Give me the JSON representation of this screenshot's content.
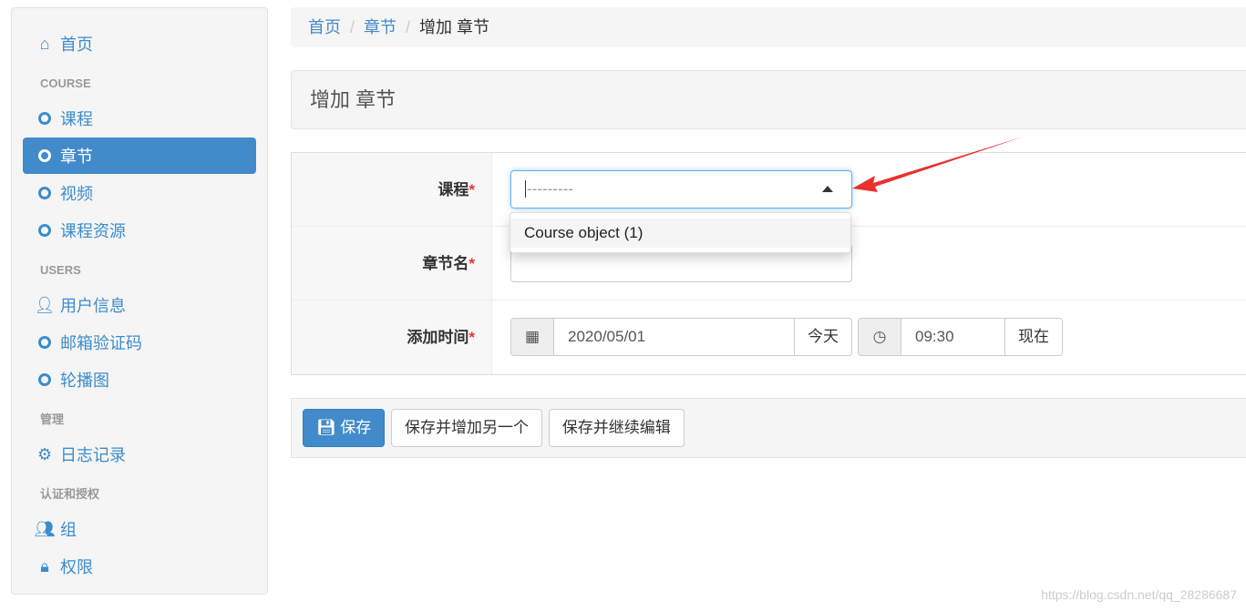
{
  "sidebar": {
    "home": "首页",
    "sections": [
      {
        "header": "COURSE",
        "items": [
          "课程",
          "章节",
          "视频",
          "课程资源"
        ]
      },
      {
        "header": "USERS",
        "items": [
          "用户信息",
          "邮箱验证码",
          "轮播图"
        ]
      },
      {
        "header": "管理",
        "items": [
          "日志记录"
        ]
      },
      {
        "header": "认证和授权",
        "items": [
          "组",
          "权限"
        ]
      }
    ]
  },
  "breadcrumb": [
    "首页",
    "章节",
    "增加 章节"
  ],
  "page_title": "增加 章节",
  "form": {
    "course_label": "课程",
    "course_value": "---------",
    "course_option": "Course object (1)",
    "name_label": "章节名",
    "time_label": "添加时间",
    "date": "2020/05/01",
    "today": "今天",
    "time": "09:30",
    "now": "现在",
    "required": "*"
  },
  "actions": {
    "save": "保存",
    "save_add": "保存并增加另一个",
    "save_continue": "保存并继续编辑"
  },
  "watermark": "https://blog.csdn.net/qq_28286687",
  "colors": {
    "accent": "#428bca",
    "arrow": "#e8312f"
  }
}
